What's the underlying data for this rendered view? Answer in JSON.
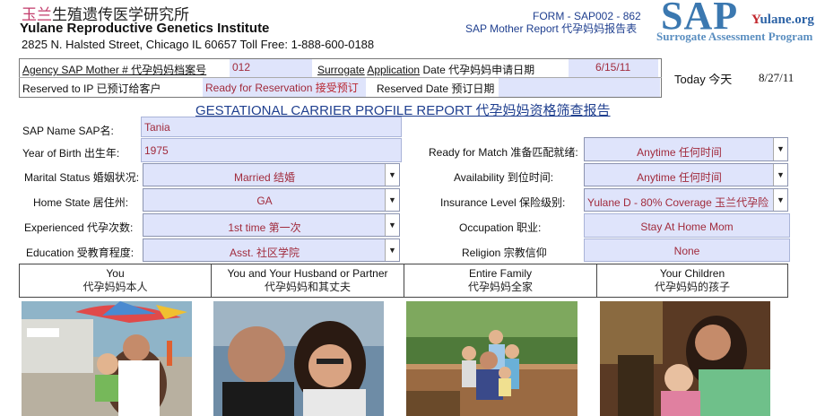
{
  "header": {
    "institute_cn_red": "玉兰",
    "institute_cn_rest": "生殖遗传医学研究所",
    "institute_en": "Yulane Reproductive Genetics Institute",
    "address": "2825 N. Halsted Street, Chicago IL 60657  Toll Free: 1-888-600-0188",
    "form_code": "FORM - SAP002 - 862",
    "form_title": "SAP Mother Report 代孕妈妈报告表",
    "logo_sap": "SAP",
    "logo_yulane_y": "Y",
    "logo_yulane_rest": "ulane.org",
    "logo_sub": "Surrogate Assessment Program"
  },
  "top_fields": {
    "agency_label": "Agency SAP Mother # 代孕妈妈档案号",
    "agency_value": "012",
    "app_date_label_1": "Surrogate",
    "app_date_label_2": "Application",
    "app_date_label_3": "Date 代孕妈妈申请日期",
    "app_date_value": "6/15/11",
    "reserved_ip_label": "Reserved to IP  已预订给客户",
    "status_value": "Ready for Reservation ",
    "status_value_cn": "接受预订",
    "reserved_date_label": "Reserved Date 预订日期",
    "reserved_date_value": "",
    "today_label": "Today 今天",
    "today_value": "8/27/11"
  },
  "report_title": "GESTATIONAL CARRIER PROFILE REPORT 代孕妈妈资格筛查报告",
  "profile": {
    "name_label": "SAP Name SAP名:",
    "name_value": "Tania",
    "yob_label": "Year of Birth 出生年:",
    "yob_value": "1975",
    "marital_label": "Marital Status 婚姻状况:",
    "marital_value": "Married 结婚",
    "state_label": "Home State 居住州:",
    "state_value": "GA",
    "experienced_label": "Experienced  代孕次数:",
    "experienced_value": "1st time  第一次",
    "education_label": "Education 受教育程度:",
    "education_value": "Asst. 社区学院",
    "ready_label": "Ready for Match 准备匹配就绪:",
    "ready_value": "Anytime 任何时间",
    "availability_label": "Availability 到位时间:",
    "availability_value": "Anytime 任何时间",
    "insurance_label": "Insurance Level 保险级别:",
    "insurance_value": "Yulane D - 80% Coverage 玉兰代孕险",
    "occupation_label": "Occupation  职业:",
    "occupation_value": "Stay At Home Mom",
    "religion_label": "Religion 宗教信仰",
    "religion_value": "None"
  },
  "photos": [
    {
      "en": "You",
      "cn": "代孕妈妈本人"
    },
    {
      "en": "You and Your Husband or Partner",
      "cn": "代孕妈妈和其丈夫"
    },
    {
      "en": "Entire Family",
      "cn": "代孕妈妈全家"
    },
    {
      "en": "Your Children",
      "cn": "代孕妈妈的孩子"
    }
  ],
  "colors": {
    "field_bg": "#dfe4fb",
    "value_text": "#a12b3d",
    "title_blue": "#1f3f8f"
  }
}
